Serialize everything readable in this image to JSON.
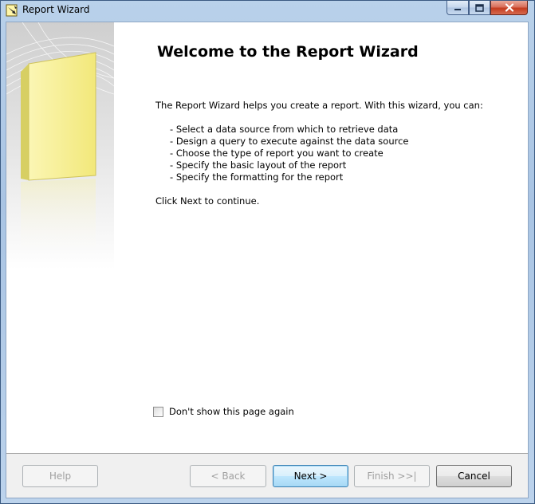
{
  "window": {
    "title": "Report Wizard",
    "accent": "#b9d1ea",
    "close_color": "#c43c1f"
  },
  "icons": {
    "app": "report-wizard-icon",
    "minimize": "minimize-icon",
    "maximize": "maximize-icon",
    "close": "close-icon",
    "side_art": "wizard-book-illustration"
  },
  "page": {
    "heading": "Welcome to the Report Wizard",
    "intro": "The Report Wizard helps you create a report. With this wizard, you can:",
    "bullets": [
      "Select a data source from which to retrieve data",
      "Design a query to execute against the data source",
      "Choose the type of report you want to create",
      "Specify the basic layout of the report",
      "Specify the formatting for the report"
    ],
    "continue_text": "Click Next to continue.",
    "dont_show_label": "Don't show this page again",
    "dont_show_checked": false
  },
  "buttons": {
    "help": "Help",
    "back": "< Back",
    "next": "Next >",
    "finish": "Finish >>|",
    "cancel": "Cancel"
  }
}
